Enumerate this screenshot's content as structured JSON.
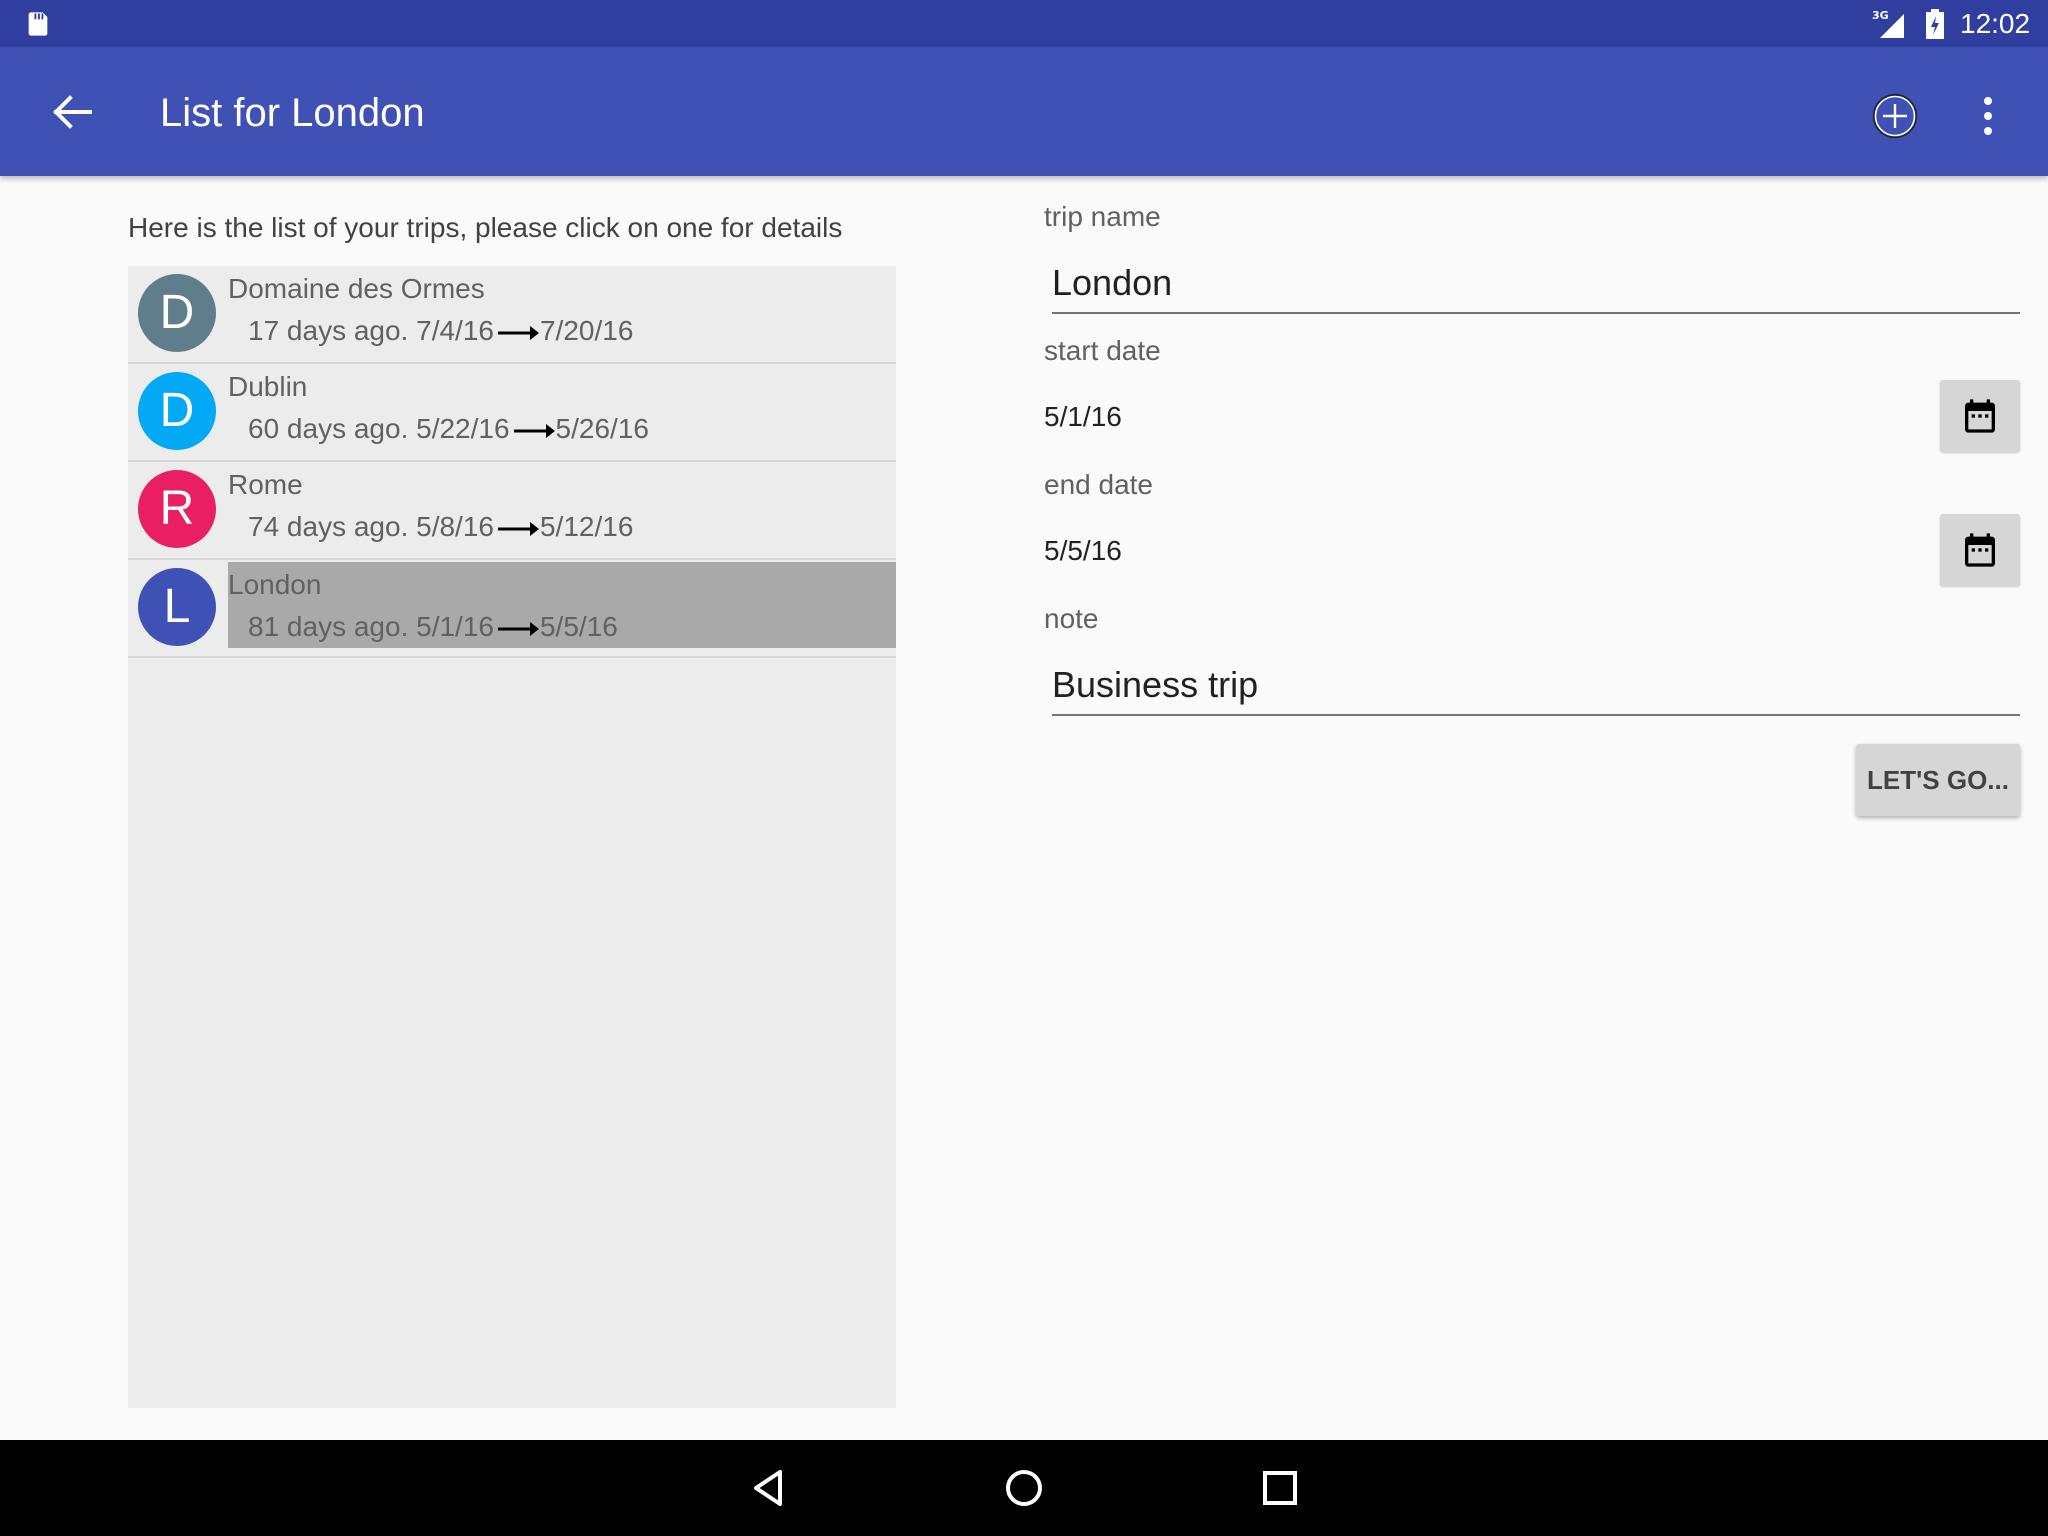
{
  "status_bar": {
    "time": "12:02",
    "network": "3G"
  },
  "app_bar": {
    "title": "List for London",
    "color": "#3f51b5",
    "status_color": "#303f9f"
  },
  "trip_list": {
    "intro": "Here is the list of your trips, please click on one for details",
    "items": [
      {
        "initial": "D",
        "name": "Domaine des Ormes",
        "ago": "17 days ago.",
        "start": "7/4/16",
        "end": "7/20/16",
        "color": "#607d8b",
        "selected": false
      },
      {
        "initial": "D",
        "name": "Dublin",
        "ago": "60 days ago.",
        "start": "5/22/16",
        "end": "5/26/16",
        "color": "#03a9f4",
        "selected": false
      },
      {
        "initial": "R",
        "name": "Rome",
        "ago": "74 days ago.",
        "start": "5/8/16",
        "end": "5/12/16",
        "color": "#e91e63",
        "selected": false
      },
      {
        "initial": "L",
        "name": "London",
        "ago": "81 days ago.",
        "start": "5/1/16",
        "end": "5/5/16",
        "color": "#3f51b5",
        "selected": true
      }
    ]
  },
  "form": {
    "trip_name_label": "trip name",
    "trip_name_value": "London",
    "start_date_label": "start date",
    "start_date_value": "5/1/16",
    "end_date_label": "end date",
    "end_date_value": "5/5/16",
    "note_label": "note",
    "note_value": "Business trip",
    "go_button": "LET'S GO..."
  }
}
